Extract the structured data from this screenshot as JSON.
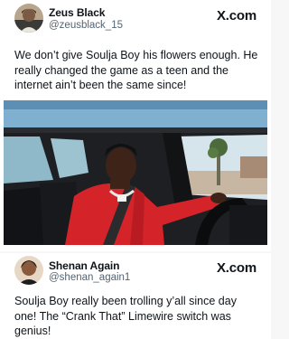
{
  "posts": [
    {
      "display_name": "Zeus Black",
      "handle": "@zeusblack_15",
      "brand": "X.com",
      "text": "We don’t give Soulja Boy his flowers enough. He really changed the game as a teen and the internet ain’t been the same since!",
      "avatar_icon": "avatar-photo-icon",
      "image_icon": "car-driver-photo-icon"
    },
    {
      "display_name": "Shenan Again",
      "handle": "@shenan_again1",
      "brand": "X.com",
      "text": "Soulja Boy really been trolling y’all since day one! The “Crank That” Limewire switch was genius!",
      "avatar_icon": "avatar-photo-icon"
    }
  ],
  "colors": {
    "text": "#0f1419",
    "secondary": "#536471",
    "background": "#ffffff",
    "separator": "#f7f7f7"
  }
}
